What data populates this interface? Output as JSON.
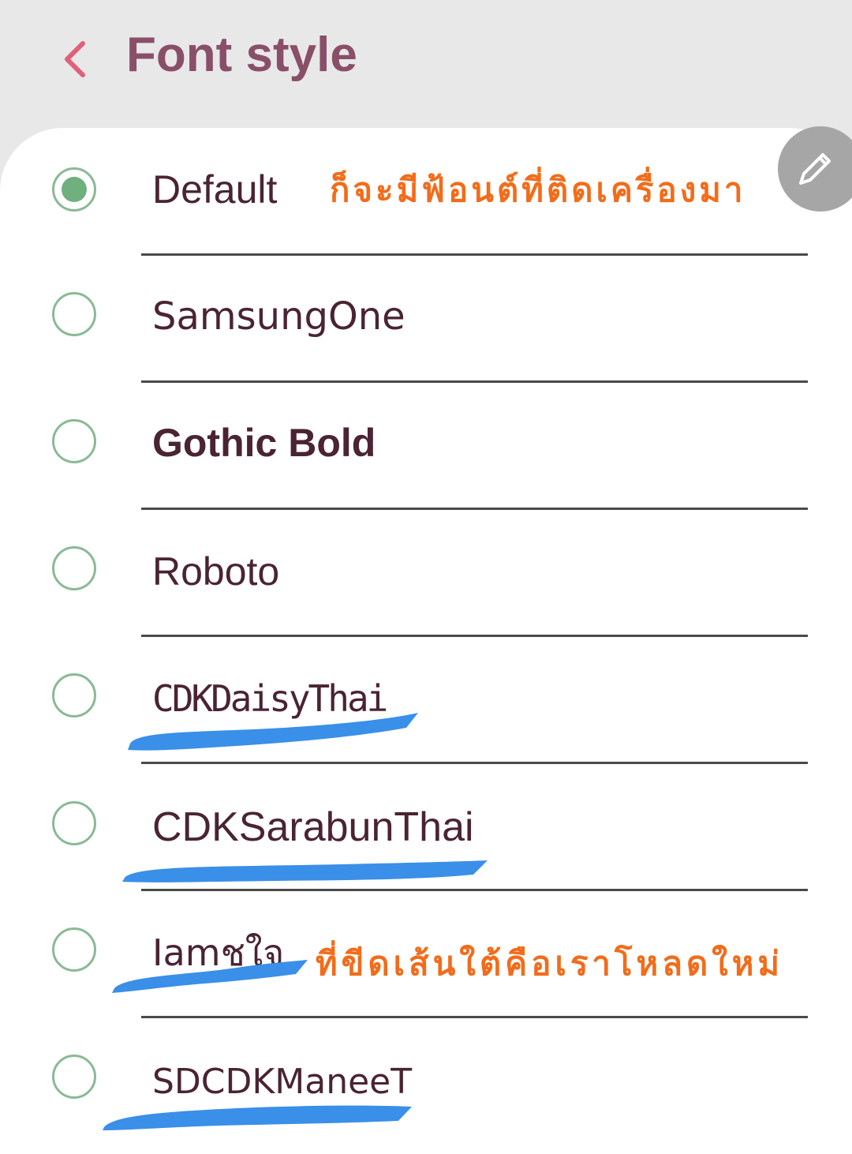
{
  "header": {
    "title": "Font style",
    "back_icon": "chevron-left-icon"
  },
  "fonts": [
    {
      "label": "Default",
      "selected": true
    },
    {
      "label": "SamsungOne",
      "selected": false
    },
    {
      "label": "Gothic Bold",
      "selected": false
    },
    {
      "label": "Roboto",
      "selected": false
    },
    {
      "label": "CDKDaisyThai",
      "selected": false
    },
    {
      "label": "CDKSarabunThai",
      "selected": false
    },
    {
      "label": "Iamชใจ",
      "selected": false
    },
    {
      "label": "SDCDKManeeT",
      "selected": false
    }
  ],
  "annotations": {
    "preinstalled": "ก็จะมีฟ้อนต์ที่ติดเครื่องมา",
    "downloaded": "ที่ขีดเส้นใต้คือเราโหลดใหม่"
  },
  "edit_button": {
    "icon": "pencil-icon"
  },
  "colors": {
    "title": "#8a4f68",
    "back_icon": "#e0607a",
    "radio_border": "#8bb996",
    "radio_fill": "#6fb07e",
    "annotation": "#f26c1a",
    "underline_marker": "#3a8fe8",
    "edit_button_bg": "#a6a6a6"
  }
}
